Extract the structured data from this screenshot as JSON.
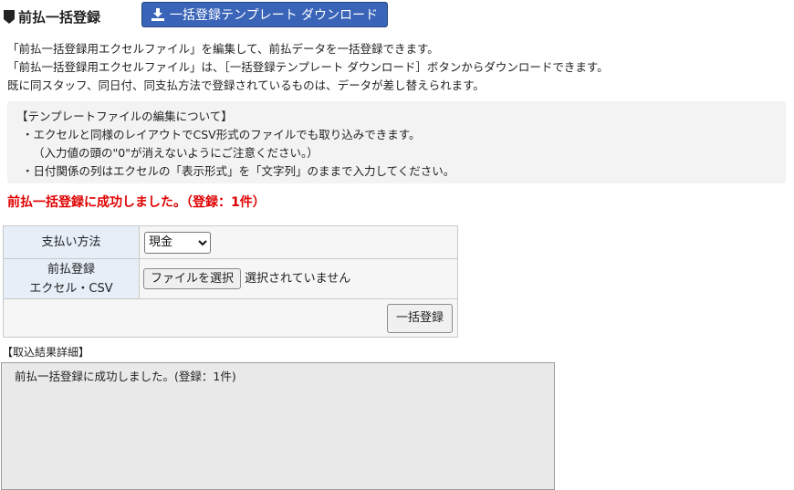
{
  "header": {
    "title": "前払一括登録",
    "download_label": "一括登録テンプレート ダウンロード"
  },
  "intro": [
    "「前払一括登録用エクセルファイル」を編集して、前払データを一括登録できます。",
    "「前払一括登録用エクセルファイル」は、［一括登録テンプレート ダウンロード］ボタンからダウンロードできます。",
    "既に同スタッフ、同日付、同支払方法で登録されているものは、データが差し替えられます。"
  ],
  "note": {
    "heading": "【テンプレートファイルの編集について】",
    "lines": [
      "・エクセルと同様のレイアウトでCSV形式のファイルでも取り込みできます。",
      "（入力値の頭の\"0\"が消えないようにご注意ください。）",
      "・日付関係の列はエクセルの「表示形式」を「文字列」のままで入力してください。"
    ]
  },
  "success_message": "前払一括登録に成功しました。（登録：1件）",
  "form": {
    "payment_label": "支払い方法",
    "payment_selected": "現金",
    "file_label_line1": "前払登録",
    "file_label_line2": "エクセル・CSV",
    "file_button": "ファイルを選択",
    "file_status": "選択されていません",
    "submit_label": "一括登録"
  },
  "result": {
    "label": "【取込結果詳細】",
    "text": "前払一括登録に成功しました。(登録：1件)"
  },
  "colors": {
    "accent": "#3a64b8",
    "success": "#e00000",
    "label_bg": "#e6eef8"
  }
}
